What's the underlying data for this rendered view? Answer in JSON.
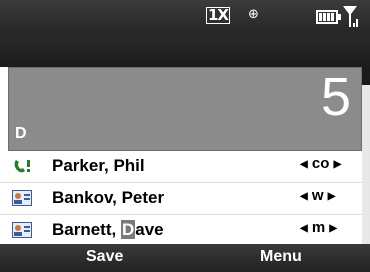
{
  "status_bar": {
    "network_indicator": "1X",
    "roaming_icon": "roaming-icon",
    "battery_icon": "battery-icon",
    "signal_icon": "signal-icon"
  },
  "search": {
    "typed_digits": "5",
    "matched_letter": "D"
  },
  "contacts": [
    {
      "name": "Parker, Phil",
      "phone_type": "co",
      "icon": "voicemail-phone-icon"
    },
    {
      "name": "Bankov, Peter",
      "phone_type": "w",
      "icon": "contact-card-icon"
    },
    {
      "name_pre": "Barnett, ",
      "name_hl": "D",
      "name_post": "ave",
      "phone_type": "m",
      "icon": "contact-card-icon"
    }
  ],
  "softkeys": {
    "left": "Save",
    "right": "Menu"
  },
  "colors": {
    "bar_dark": "#262626",
    "panel_gray": "#8c8c8c",
    "highlight": "#7a7a7a"
  }
}
